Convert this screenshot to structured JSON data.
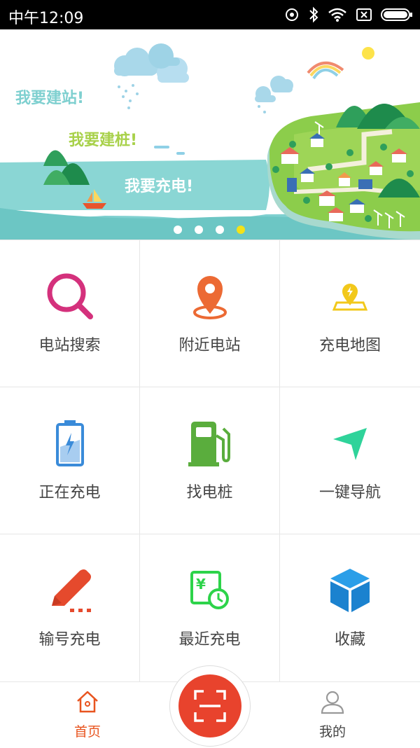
{
  "status_bar": {
    "time": "中午12:09"
  },
  "banner": {
    "slogans": [
      "我要建站!",
      "我要建桩!",
      "我要充电!"
    ],
    "page_count": 4,
    "active_page": 4
  },
  "menu": [
    {
      "label": "电站搜索",
      "icon": "search-icon"
    },
    {
      "label": "附近电站",
      "icon": "location-pin-icon"
    },
    {
      "label": "充电地图",
      "icon": "charge-map-icon"
    },
    {
      "label": "正在充电",
      "icon": "battery-charging-icon"
    },
    {
      "label": "找电桩",
      "icon": "charging-pile-icon"
    },
    {
      "label": "一键导航",
      "icon": "navigation-arrow-icon"
    },
    {
      "label": "输号充电",
      "icon": "pencil-icon"
    },
    {
      "label": "最近充电",
      "icon": "recent-charge-icon"
    },
    {
      "label": "收藏",
      "icon": "cube-icon"
    }
  ],
  "tab_bar": {
    "home_label": "首页",
    "mine_label": "我的",
    "scan_icon": "scan-icon"
  },
  "colors": {
    "accent": "#e8432d",
    "home_active": "#e8541f"
  }
}
